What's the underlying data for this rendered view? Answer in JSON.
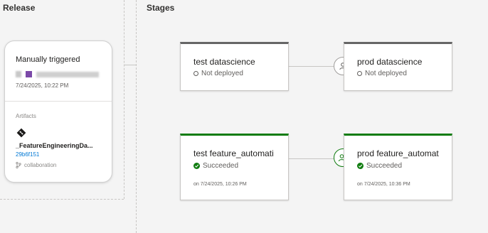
{
  "sections": {
    "release_title": "Release",
    "stages_title": "Stages"
  },
  "release": {
    "trigger": "Manually triggered",
    "date": "7/24/2025, 10:22 PM",
    "artifacts_label": "Artifacts",
    "artifact_name": "_FeatureEngineeringDa...",
    "commit": "29b6f151",
    "branch": "collaboration"
  },
  "stages": [
    {
      "name": "test datascience",
      "status": "Not deployed",
      "time": ""
    },
    {
      "name": "prod datascience",
      "status": "Not deployed",
      "time": ""
    },
    {
      "name": "test feature_automati",
      "status": "Succeeded",
      "time": "on 7/24/2025, 10:26 PM"
    },
    {
      "name": "prod feature_automat",
      "status": "Succeeded",
      "time": "on 7/24/2025, 10:36 PM"
    }
  ],
  "colors": {
    "success": "#107c10",
    "not_deployed_bar": "#666666",
    "link": "#0078d4"
  },
  "icons": {
    "approval_pending": "person-icon",
    "approval_done": "person-check-icon",
    "artifact": "git-diamond-icon",
    "branch": "branch-icon"
  }
}
